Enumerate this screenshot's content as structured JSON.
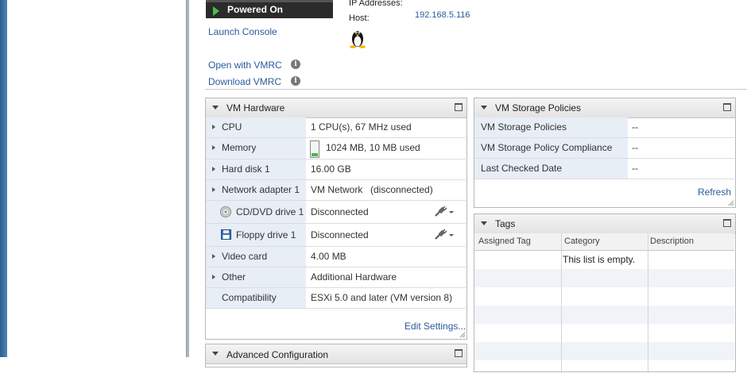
{
  "vm_summary": {
    "power_state": "Powered On",
    "launch_console": "Launch Console",
    "ip_label": "IP Addresses:",
    "host_label": "Host:",
    "host_value": "192.168.5.116",
    "open_vmrc": "Open with VMRC",
    "download_vmrc": "Download VMRC",
    "info_glyph": "i"
  },
  "vm_hardware": {
    "title": "VM Hardware",
    "rows": [
      {
        "label": "CPU",
        "value": "1 CPU(s), 67 MHz used"
      },
      {
        "label": "Memory",
        "value": "1024 MB, 10 MB used"
      },
      {
        "label": "Hard disk 1",
        "value": "16.00 GB"
      },
      {
        "label": "Network adapter 1",
        "value_link": "VM Network",
        "value": "(disconnected)"
      },
      {
        "label": "CD/DVD drive 1",
        "value": "Disconnected"
      },
      {
        "label": "Floppy drive 1",
        "value": "Disconnected"
      },
      {
        "label": "Video card",
        "value": "4.00 MB"
      },
      {
        "label": "Other",
        "value": "Additional Hardware"
      },
      {
        "label": "Compatibility",
        "value": "ESXi 5.0 and later (VM version 8)"
      }
    ],
    "edit_settings": "Edit Settings..."
  },
  "advanced_config": {
    "title": "Advanced Configuration"
  },
  "storage_policies": {
    "title": "VM Storage Policies",
    "rows": [
      {
        "label": "VM Storage Policies",
        "value": "--"
      },
      {
        "label": "VM Storage Policy Compliance",
        "value": "--"
      },
      {
        "label": "Last Checked Date",
        "value": "--"
      }
    ],
    "refresh": "Refresh"
  },
  "tags": {
    "title": "Tags",
    "columns": [
      "Assigned Tag",
      "Category",
      "Description"
    ],
    "empty_text": "This list is empty."
  },
  "colors": {
    "link": "#2a5b9c",
    "label_bg": "#e8eef6",
    "power_green": "#4dbd4d"
  }
}
